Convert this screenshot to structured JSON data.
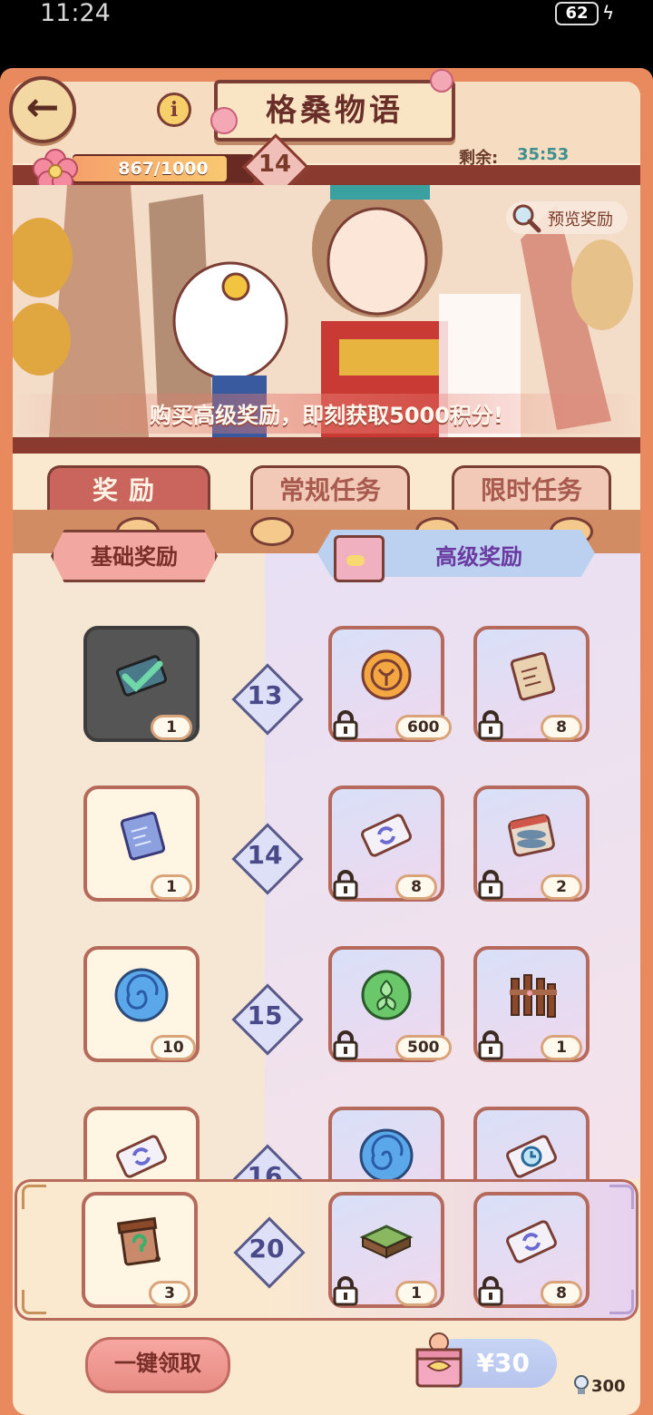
{
  "status_bar": {
    "time": "11:24",
    "battery": "62"
  },
  "header": {
    "title": "格桑物语",
    "remaining_label": "剩余:",
    "remaining_time": "35:53",
    "progress_text": "867/1000",
    "progress_fraction": 0.867,
    "current_level": "14"
  },
  "banner": {
    "preview_label": "预览奖励",
    "caption": "购买高级奖励，即刻获取5000积分!"
  },
  "tabs": {
    "rewards": "奖励",
    "normal_tasks": "常规任务",
    "limited_tasks": "限时任务"
  },
  "columns": {
    "basic": "基础奖励",
    "premium": "高级奖励"
  },
  "rows": [
    {
      "level": "13",
      "basic": {
        "icon": "ticket-claimed-icon",
        "qty": "1"
      },
      "premium": [
        {
          "icon": "coin-icon",
          "qty": "600"
        },
        {
          "icon": "blueprint-scroll-icon",
          "qty": "8"
        }
      ]
    },
    {
      "level": "14",
      "basic": {
        "icon": "blue-scroll-icon",
        "qty": "1"
      },
      "premium": [
        {
          "icon": "refresh-ticket-icon",
          "qty": "8"
        },
        {
          "icon": "fish-can-icon",
          "qty": "2"
        }
      ]
    },
    {
      "level": "15",
      "basic": {
        "icon": "blue-orb-icon",
        "qty": "10"
      },
      "premium": [
        {
          "icon": "green-leaf-coin-icon",
          "qty": "500"
        },
        {
          "icon": "wooden-fence-icon",
          "qty": "1"
        }
      ]
    },
    {
      "level": "16",
      "basic": {
        "icon": "refresh-ticket-icon",
        "qty": ""
      },
      "premium": [
        {
          "icon": "blue-orb-icon",
          "qty": ""
        },
        {
          "icon": "clock-ticket-icon",
          "qty": ""
        }
      ]
    }
  ],
  "bottom_row": {
    "level": "20",
    "basic": {
      "icon": "seed-bag-icon",
      "qty": "3"
    },
    "premium": [
      {
        "icon": "grass-tile-icon",
        "qty": "1"
      },
      {
        "icon": "refresh-ticket-icon",
        "qty": "8"
      }
    ]
  },
  "footer": {
    "claim_all": "一键领取",
    "price": "¥30",
    "points": "300"
  },
  "colors": {
    "frame": "#e98a5e",
    "accent_dark": "#7a3e34",
    "active_tab": "#c9655c",
    "teal": "#3e8f8f"
  }
}
